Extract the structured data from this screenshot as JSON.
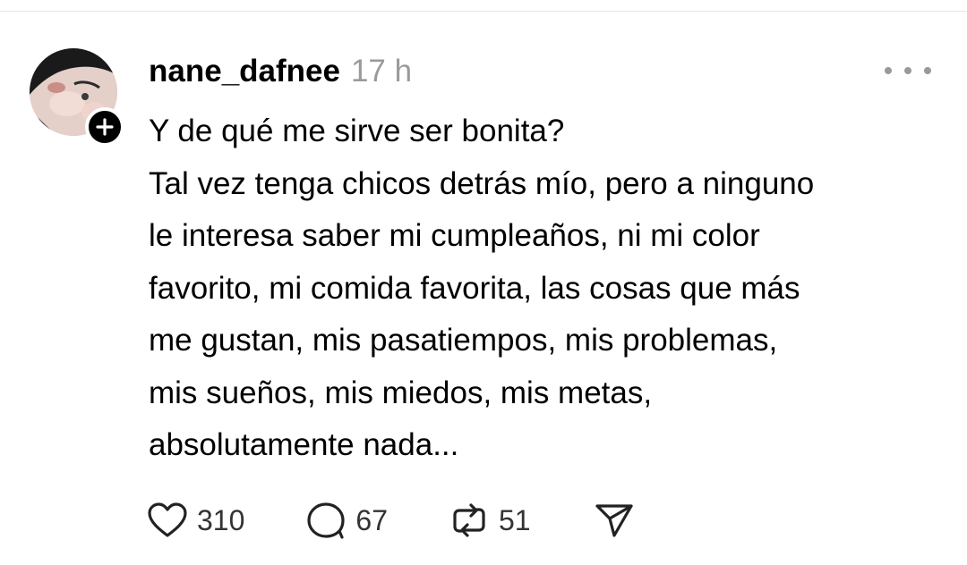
{
  "post": {
    "username": "nane_dafnee",
    "time": "17 h",
    "lines": [
      "Y de qué me sirve ser bonita?",
      "Tal vez tenga chicos detrás mío, pero a ninguno",
      "le interesa saber mi cumpleaños, ni mi color",
      "favorito, mi comida favorita, las cosas que más",
      "me gustan, mis pasatiempos, mis problemas,",
      "mis sueños, mis miedos, mis metas,",
      "absolutamente nada..."
    ],
    "likes": "310",
    "replies": "67",
    "reposts": "51"
  },
  "icons": {
    "avatar": "profile-photo",
    "follow": "plus-icon",
    "more": "more-horizontal-icon",
    "like": "heart-icon",
    "reply": "comment-icon",
    "repost": "repost-icon",
    "share": "send-icon"
  },
  "colors": {
    "text": "#000000",
    "muted": "#9a9a9a",
    "count": "#333333"
  }
}
